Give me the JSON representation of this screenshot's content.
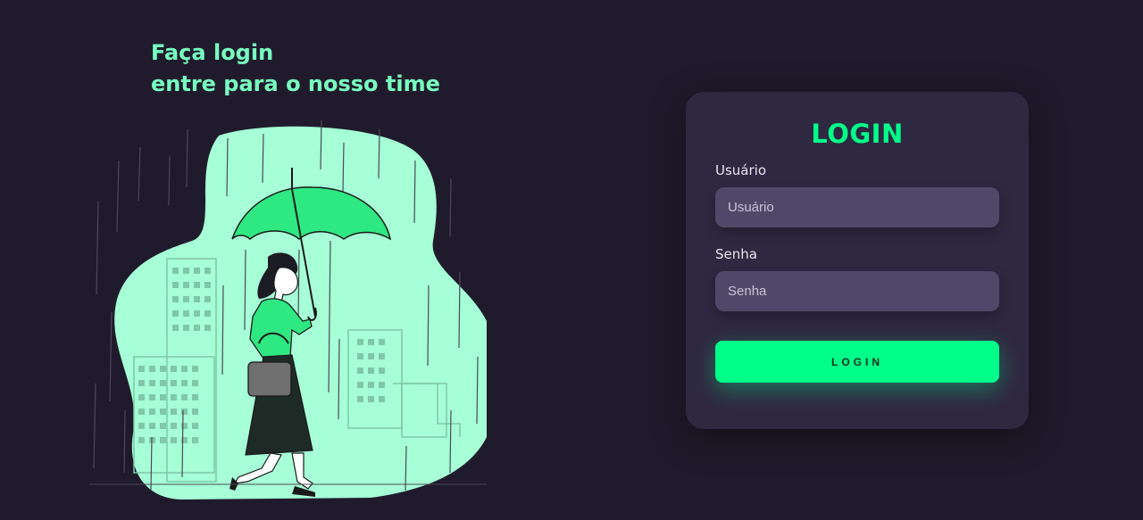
{
  "headline": {
    "line1": "Faça login",
    "line2": "entre para o nosso time"
  },
  "form": {
    "title": "LOGIN",
    "username_label": "Usuário",
    "username_placeholder": "Usuário",
    "username_value": "",
    "password_label": "Senha",
    "password_placeholder": "Senha",
    "password_value": "",
    "submit_label": "LOGIN"
  },
  "colors": {
    "background": "#201b2c",
    "accent": "#00ff88",
    "headline": "#77ffc0",
    "card": "#2f2841",
    "input": "#514869"
  },
  "illustration": {
    "icon": "woman-with-umbrella-in-rain-illustration"
  }
}
